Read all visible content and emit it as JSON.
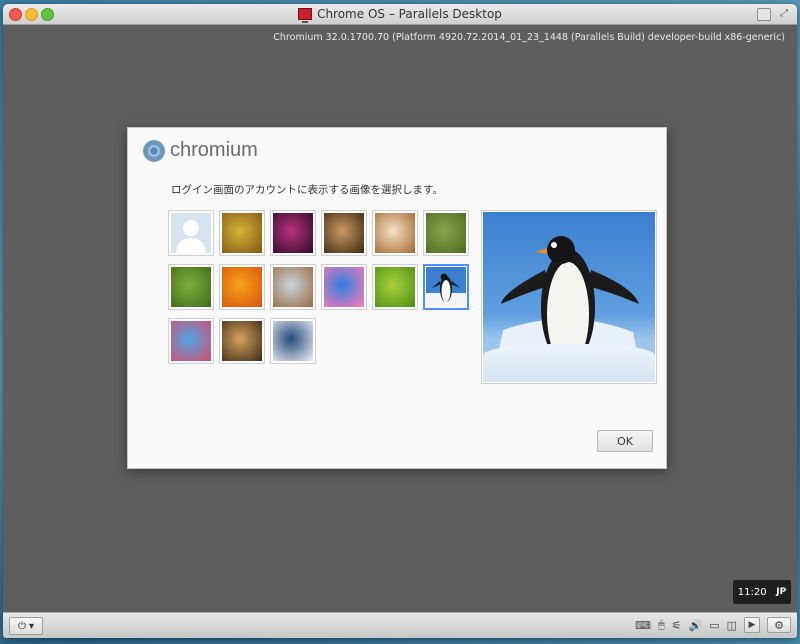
{
  "window": {
    "title": "Chrome OS – Parallels Desktop"
  },
  "screen": {
    "build_info": "Chromium 32.0.1700.70 (Platform 4920.72.2014_01_23_1448 (Parallels Build) developer-build x86-generic)"
  },
  "dialog": {
    "logo_text": "chromium",
    "instruction": "ログイン画面のアカウントに表示する画像を選択します。",
    "images": [
      {
        "name": "default-avatar",
        "colors": [
          "#d7e3ef",
          "#ffffff"
        ]
      },
      {
        "name": "bicycle",
        "colors": [
          "#d9b13a",
          "#7c5a12"
        ]
      },
      {
        "name": "bokeh",
        "colors": [
          "#b9317b",
          "#2c0b2b"
        ]
      },
      {
        "name": "chess",
        "colors": [
          "#c99a64",
          "#3b2612"
        ]
      },
      {
        "name": "coffee",
        "colors": [
          "#f3e1c6",
          "#a5672c"
        ]
      },
      {
        "name": "dragonfly",
        "colors": [
          "#8aa34a",
          "#4f6a24"
        ]
      },
      {
        "name": "grass",
        "colors": [
          "#7fae3e",
          "#3f6a18"
        ]
      },
      {
        "name": "flower",
        "colors": [
          "#f7a21b",
          "#d8530d"
        ]
      },
      {
        "name": "dog",
        "colors": [
          "#c8d4e0",
          "#9a6b3d"
        ]
      },
      {
        "name": "jellyfish",
        "colors": [
          "#2d7fe0",
          "#ff7bb4"
        ]
      },
      {
        "name": "kiwi",
        "colors": [
          "#a6d23c",
          "#4e8d14"
        ]
      },
      {
        "name": "penguin",
        "colors": [
          "#3b80d0",
          "#f2f6fb"
        ]
      },
      {
        "name": "rocket",
        "colors": [
          "#4ea6e6",
          "#d74b6b"
        ]
      },
      {
        "name": "record-player",
        "colors": [
          "#d6a15a",
          "#3a2b18"
        ]
      },
      {
        "name": "lotus",
        "colors": [
          "#234a78",
          "#f1f1f8"
        ]
      }
    ],
    "selected_index": 11,
    "ok_label": "OK"
  },
  "status": {
    "time": "11:20",
    "ime": "JP"
  }
}
